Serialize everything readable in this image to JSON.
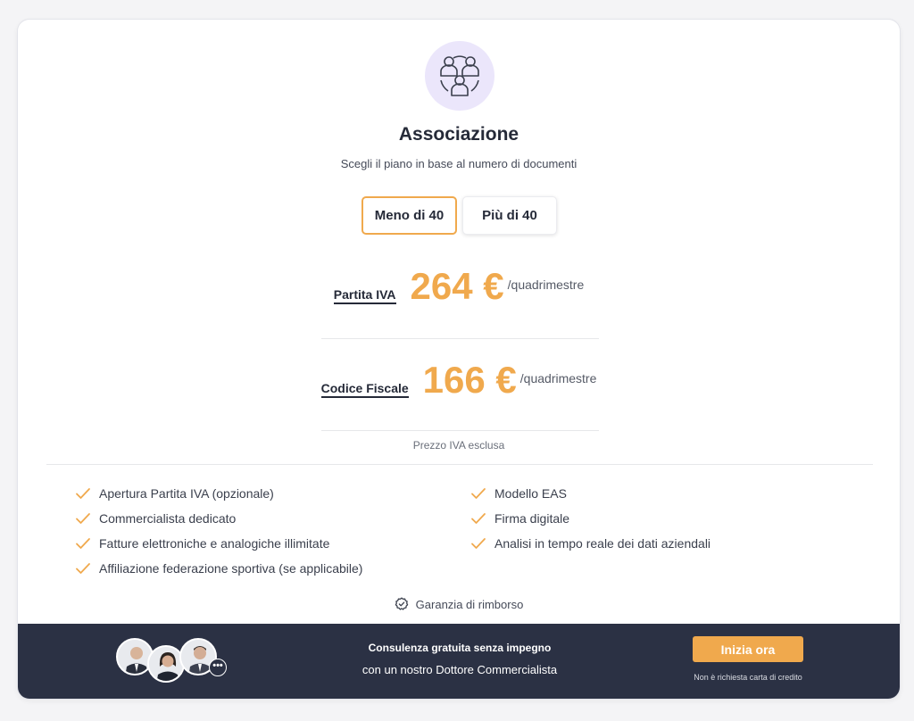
{
  "plan": {
    "title": "Associazione",
    "subtitle": "Scegli il piano in base al numero di documenti"
  },
  "toggle": {
    "options": [
      {
        "label": "Meno di 40",
        "selected": true
      },
      {
        "label": "Più di 40",
        "selected": false
      }
    ]
  },
  "prices": [
    {
      "label": "Partita IVA",
      "amount": "264 €",
      "period": "/quadrimestre"
    },
    {
      "label": "Codice Fiscale",
      "amount": "166 €",
      "period": "/quadrimestre"
    }
  ],
  "vat_note": "Prezzo IVA esclusa",
  "features": {
    "left": [
      "Apertura Partita IVA (opzionale)",
      "Commercialista dedicato",
      "Fatture elettroniche e analogiche illimitate",
      "Affiliazione federazione sportiva (se applicabile)"
    ],
    "right": [
      "Modello EAS",
      "Firma digitale",
      "Analisi in tempo reale dei dati aziendali"
    ]
  },
  "guarantee": "Garanzia di rimborso",
  "footer": {
    "consult_title": "Consulenza gratuita senza impegno",
    "consult_subtitle": "con un nostro Dottore Commercialista",
    "cta_label": "Inizia ora",
    "cta_note": "Non è richiesta carta di credito",
    "more_badge": "•••"
  },
  "colors": {
    "accent": "#f0a94d",
    "footer_bg": "#2b3144",
    "icon_bg": "#ebe6fb",
    "text_dark": "#252a38"
  },
  "icons": {
    "hero": "group-people-icon",
    "feature": "check-icon",
    "guarantee": "badge-check-icon"
  }
}
